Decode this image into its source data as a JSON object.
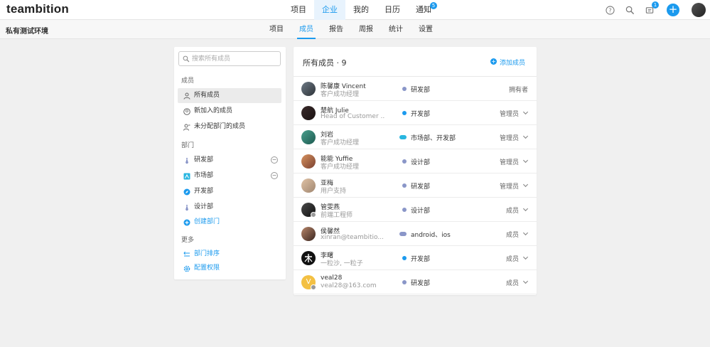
{
  "app": {
    "logo": "teambition"
  },
  "topnav": [
    {
      "label": "项目",
      "active": false
    },
    {
      "label": "企业",
      "active": true
    },
    {
      "label": "我的",
      "active": false
    },
    {
      "label": "日历",
      "active": false
    },
    {
      "label": "通知",
      "active": false,
      "badge": "5"
    }
  ],
  "topright": {
    "inbox_badge": "1",
    "plus": "+"
  },
  "org_name": "私有测试环境",
  "subnav": [
    {
      "label": "项目",
      "active": false
    },
    {
      "label": "成员",
      "active": true
    },
    {
      "label": "报告",
      "active": false
    },
    {
      "label": "周报",
      "active": false
    },
    {
      "label": "统计",
      "active": false
    },
    {
      "label": "设置",
      "active": false
    }
  ],
  "sidebar": {
    "search_placeholder": "搜索所有成员",
    "members_heading": "成员",
    "member_items": [
      "所有成员",
      "新加入的成员",
      "未分配部门的成员"
    ],
    "dept_heading": "部门",
    "dept_items": [
      "研发部",
      "市场部",
      "开发部",
      "设计部"
    ],
    "create_dept": "创建部门",
    "more_heading": "更多",
    "more_items": [
      "部门排序",
      "配置权限"
    ]
  },
  "main": {
    "title": "所有成员 · 9",
    "add_member": "添加成员",
    "members": [
      {
        "name": "陈馨康 Vincent",
        "title": "客户成功经理",
        "dept": "研发部",
        "role": "拥有者",
        "dot": "#8a96c8",
        "has_chevron": false
      },
      {
        "name": "楚航 Julie",
        "title": "Head of Customer ...",
        "dept": "开发部",
        "role": "管理员",
        "dot": "#1b9aee",
        "has_chevron": true
      },
      {
        "name": "刘岩",
        "title": "客户成功经理",
        "dept": "市场部、开发部",
        "role": "管理员",
        "dot": "#29b6e0",
        "has_chevron": true
      },
      {
        "name": "能能 Yuffie",
        "title": "客户成功经理",
        "dept": "设计部",
        "role": "管理员",
        "dot": "#8a96c8",
        "has_chevron": true
      },
      {
        "name": "亚梅",
        "title": "用户支持",
        "dept": "研发部",
        "role": "管理员",
        "dot": "#8a96c8",
        "has_chevron": true
      },
      {
        "name": "管雯燕",
        "title": "前端工程师",
        "dept": "设计部",
        "role": "成员",
        "dot": "#8a96c8",
        "has_chevron": true
      },
      {
        "name": "侯馨然",
        "title": "xinran@teambitio...",
        "dept": "android、ios",
        "role": "成员",
        "dot": "#8a96c8",
        "has_chevron": true
      },
      {
        "name": "李曙",
        "title": "一粒沙, 一粒子",
        "dept": "开发部",
        "role": "成员",
        "dot": "#1b9aee",
        "has_chevron": true
      },
      {
        "name": "veal28",
        "title": "veal28@163.com",
        "dept": "研发部",
        "role": "成员",
        "dot": "#8a96c8",
        "has_chevron": true
      }
    ]
  },
  "colors": {
    "accent": "#1b9aee",
    "background": "#f0f0f0"
  }
}
